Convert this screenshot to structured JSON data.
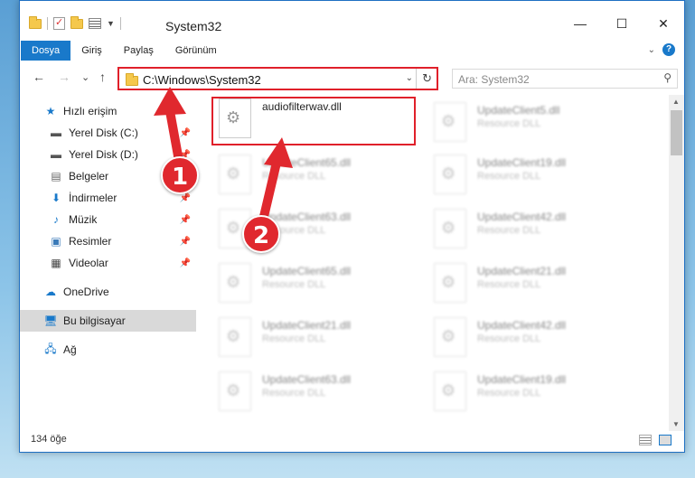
{
  "window": {
    "title": "System32",
    "controls": {
      "minimize": "—",
      "maximize": "☐",
      "close": "✕"
    }
  },
  "ribbon": {
    "tabs": [
      "Dosya",
      "Giriş",
      "Paylaş",
      "Görünüm"
    ],
    "help": "?"
  },
  "nav": {
    "back": "←",
    "forward": "→",
    "recent": "⌄",
    "up": "↑"
  },
  "address": {
    "path": "C:\\Windows\\System32",
    "refresh": "↻"
  },
  "search": {
    "placeholder": "Ara: System32"
  },
  "sidebar": {
    "items": [
      {
        "label": "Hızlı erişim",
        "icon": "star-icon",
        "pinned": false
      },
      {
        "label": "Yerel Disk (C:)",
        "icon": "drive-icon",
        "pinned": true
      },
      {
        "label": "Yerel Disk (D:)",
        "icon": "drive-icon",
        "pinned": true
      },
      {
        "label": "Belgeler",
        "icon": "document-icon",
        "pinned": true
      },
      {
        "label": "İndirmeler",
        "icon": "download-icon",
        "pinned": true
      },
      {
        "label": "Müzik",
        "icon": "music-icon",
        "pinned": true
      },
      {
        "label": "Resimler",
        "icon": "picture-icon",
        "pinned": true
      },
      {
        "label": "Videolar",
        "icon": "video-icon",
        "pinned": true
      },
      {
        "label": "OneDrive",
        "icon": "cloud-icon",
        "pinned": false
      },
      {
        "label": "Bu bilgisayar",
        "icon": "computer-icon",
        "pinned": false,
        "selected": true
      },
      {
        "label": "Ağ",
        "icon": "network-icon",
        "pinned": false
      }
    ]
  },
  "files": {
    "highlighted": {
      "name": "audiofilterwav.dll",
      "type": ""
    },
    "left_column": [
      {
        "name": "UpdateClient65.dll",
        "type": "Resource DLL"
      },
      {
        "name": "UpdateClient63.dll",
        "type": "Resource DLL"
      },
      {
        "name": "UpdateClient65.dll",
        "type": "Resource DLL"
      },
      {
        "name": "UpdateClient21.dll",
        "type": "Resource DLL"
      },
      {
        "name": "UpdateClient63.dll",
        "type": "Resource DLL"
      }
    ],
    "right_column": [
      {
        "name": "UpdateClient5.dll",
        "type": "Resource DLL"
      },
      {
        "name": "UpdateClient19.dll",
        "type": "Resource DLL"
      },
      {
        "name": "UpdateClient42.dll",
        "type": "Resource DLL"
      },
      {
        "name": "UpdateClient21.dll",
        "type": "Resource DLL"
      },
      {
        "name": "UpdateClient42.dll",
        "type": "Resource DLL"
      },
      {
        "name": "UpdateClient19.dll",
        "type": "Resource DLL"
      }
    ]
  },
  "status": {
    "count": "134 öğe"
  },
  "annotations": {
    "step1": "1",
    "step2": "2",
    "color": "#e0282e"
  }
}
